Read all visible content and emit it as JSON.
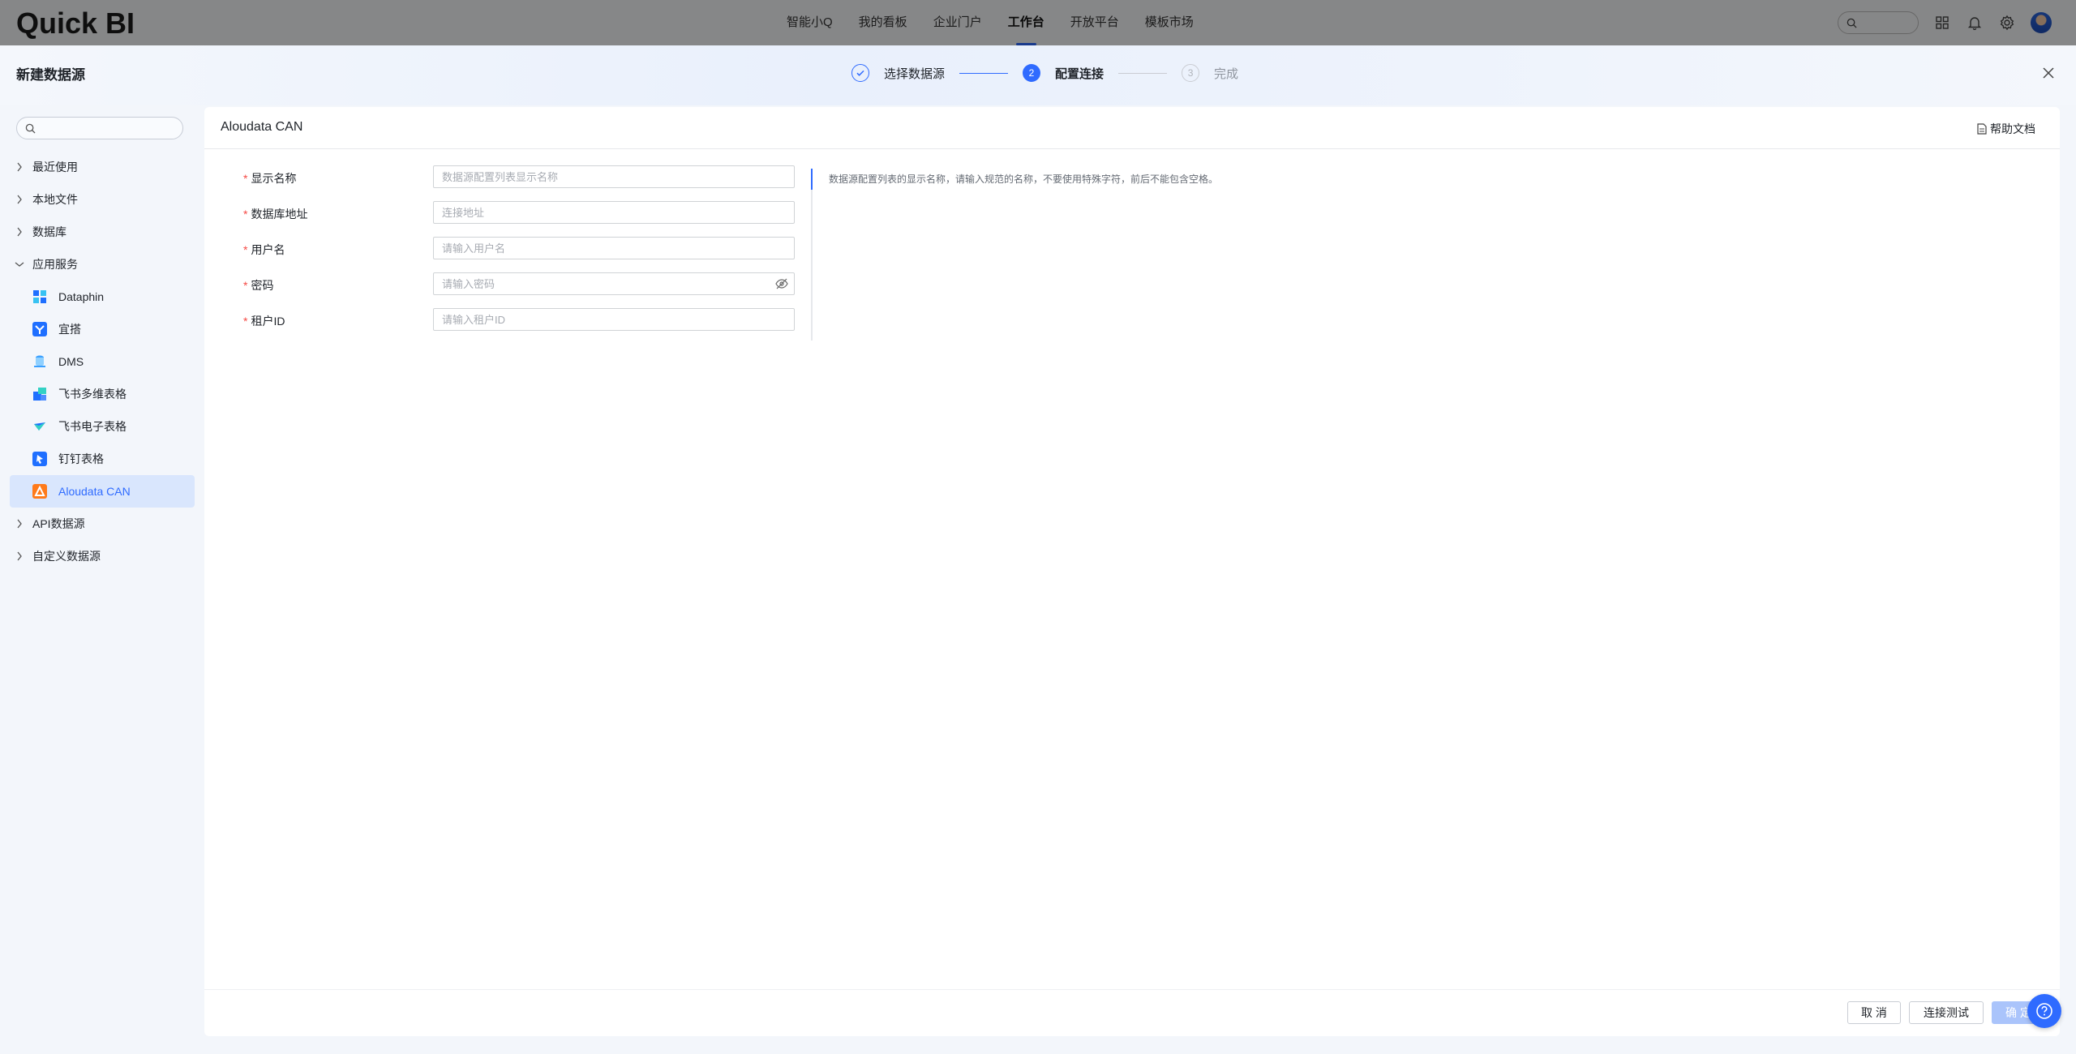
{
  "app": {
    "logo": "Quick BI",
    "nav": [
      {
        "label": "智能小Q",
        "active": false
      },
      {
        "label": "我的看板",
        "active": false
      },
      {
        "label": "企业门户",
        "active": false
      },
      {
        "label": "工作台",
        "active": true
      },
      {
        "label": "开放平台",
        "active": false
      },
      {
        "label": "模板市场",
        "active": false
      }
    ]
  },
  "modal": {
    "title": "新建数据源",
    "steps": [
      {
        "index": "1",
        "label": "选择数据源",
        "state": "done"
      },
      {
        "index": "2",
        "label": "配置连接",
        "state": "current"
      },
      {
        "index": "3",
        "label": "完成",
        "state": "todo"
      }
    ]
  },
  "sidebar": {
    "search_placeholder": "",
    "groups": [
      {
        "label": "最近使用",
        "expanded": false
      },
      {
        "label": "本地文件",
        "expanded": false
      },
      {
        "label": "数据库",
        "expanded": false
      },
      {
        "label": "应用服务",
        "expanded": true
      }
    ],
    "app_services": [
      {
        "label": "Dataphin",
        "icon": "dataphin-icon",
        "selected": false
      },
      {
        "label": "宜搭",
        "icon": "yida-icon",
        "selected": false
      },
      {
        "label": "DMS",
        "icon": "dms-icon",
        "selected": false
      },
      {
        "label": "飞书多维表格",
        "icon": "feishu-bitable-icon",
        "selected": false
      },
      {
        "label": "飞书电子表格",
        "icon": "feishu-sheet-icon",
        "selected": false
      },
      {
        "label": "钉钉表格",
        "icon": "dingtalk-sheet-icon",
        "selected": false
      },
      {
        "label": "Aloudata CAN",
        "icon": "aloudata-icon",
        "selected": true
      }
    ],
    "more_groups": [
      {
        "label": "API数据源",
        "expanded": false
      },
      {
        "label": "自定义数据源",
        "expanded": false
      }
    ]
  },
  "panel": {
    "title": "Aloudata CAN",
    "help_label": "帮助文档",
    "fields": [
      {
        "label": "显示名称",
        "placeholder": "数据源配置列表显示名称",
        "value": ""
      },
      {
        "label": "数据库地址",
        "placeholder": "连接地址",
        "value": ""
      },
      {
        "label": "用户名",
        "placeholder": "请输入用户名",
        "value": ""
      },
      {
        "label": "密码",
        "placeholder": "请输入密码",
        "value": ""
      },
      {
        "label": "租户ID",
        "placeholder": "请输入租户ID",
        "value": ""
      }
    ],
    "required_mark": "*",
    "hint": "数据源配置列表的显示名称，请输入规范的名称，不要使用特殊字符，前后不能包含空格。",
    "buttons": {
      "cancel": "取 消",
      "test": "连接测试",
      "confirm": "确 定"
    }
  },
  "colors": {
    "accent": "#2f6bff",
    "selected_bg": "#d9e6fd",
    "required": "#f54a45"
  }
}
